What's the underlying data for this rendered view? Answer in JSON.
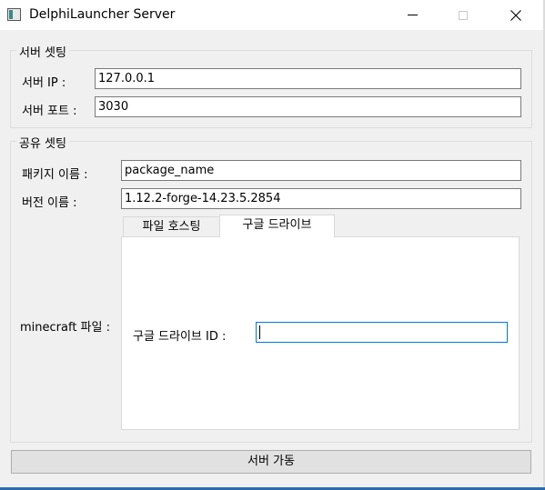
{
  "window": {
    "title": "DelphiLauncher Server"
  },
  "server_group": {
    "title": "서버 셋팅",
    "ip_label": "서버 IP :",
    "ip_value": "127.0.0.1",
    "port_label": "서버 포트 :",
    "port_value": "3030"
  },
  "share_group": {
    "title": "공유 셋팅",
    "package_label": "패키지 이름 :",
    "package_value": "package_name",
    "version_label": "버전 이름 :",
    "version_value": "1.12.2-forge-14.23.5.2854",
    "minecraft_label": "minecraft 파일 :",
    "tabs": [
      {
        "label": "파일 호스팅",
        "active": false
      },
      {
        "label": "구글 드라이브",
        "active": true
      }
    ],
    "gdrive_label": "구글 드라이브 ID :",
    "gdrive_value": ""
  },
  "actions": {
    "start_label": "서버 가동"
  },
  "icons": {
    "app": "app-window-icon",
    "minimize": "minimize-icon",
    "maximize": "maximize-icon",
    "close": "close-icon"
  },
  "colors": {
    "focus_border": "#0078d7",
    "taskbar_accent": "#2b6cb0"
  }
}
